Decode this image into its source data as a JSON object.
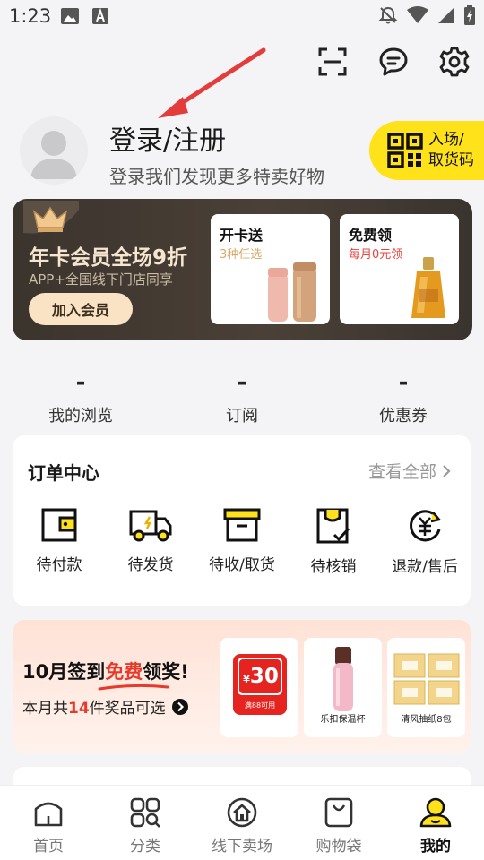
{
  "status_bar": {
    "time": "1:23"
  },
  "header": {
    "login_title": "登录/注册",
    "login_subtitle": "登录我们发现更多特卖好物",
    "entry_badge": {
      "line1": "入场/",
      "line2": "取货码"
    }
  },
  "vip_banner": {
    "title": "年卡会员全场9折",
    "subtitle": "APP+全国线下门店同享",
    "button": "加入会员",
    "cards": [
      {
        "title": "开卡送",
        "subtitle": "3种任选",
        "subtitle_color": "#d9a96a"
      },
      {
        "title": "免费领",
        "subtitle": "每月0元领",
        "subtitle_color": "#e8453c"
      }
    ]
  },
  "stats": [
    {
      "value": "-",
      "label": "我的浏览"
    },
    {
      "value": "-",
      "label": "订阅"
    },
    {
      "value": "-",
      "label": "优惠券"
    }
  ],
  "orders": {
    "title": "订单中心",
    "view_all": "查看全部",
    "items": [
      {
        "label": "待付款",
        "icon": "wallet-icon"
      },
      {
        "label": "待发货",
        "icon": "truck-icon"
      },
      {
        "label": "待收/取货",
        "icon": "box-icon"
      },
      {
        "label": "待核销",
        "icon": "clipboard-check-icon"
      },
      {
        "label": "退款/售后",
        "icon": "refund-icon"
      }
    ]
  },
  "sign_banner": {
    "title_prefix": "10月签到",
    "title_highlight": "免费",
    "title_suffix": "领奖!",
    "sub_prefix": "本月共",
    "sub_number": "14",
    "sub_suffix": "件奖品可选",
    "coupon": {
      "amount": "30",
      "currency": "¥",
      "condition": "满88可用"
    },
    "prizes": [
      {
        "label": "乐扣保温杯"
      },
      {
        "label": "清风抽纸8包"
      }
    ]
  },
  "bottom_nav": [
    {
      "label": "首页",
      "icon": "home-icon"
    },
    {
      "label": "分类",
      "icon": "category-icon"
    },
    {
      "label": "线下卖场",
      "icon": "store-icon"
    },
    {
      "label": "购物袋",
      "icon": "shopping-bag-icon"
    },
    {
      "label": "我的",
      "icon": "profile-icon",
      "active": true
    }
  ],
  "colors": {
    "accent_yellow": "#ffe21a",
    "highlight_red": "#e83a2a"
  }
}
